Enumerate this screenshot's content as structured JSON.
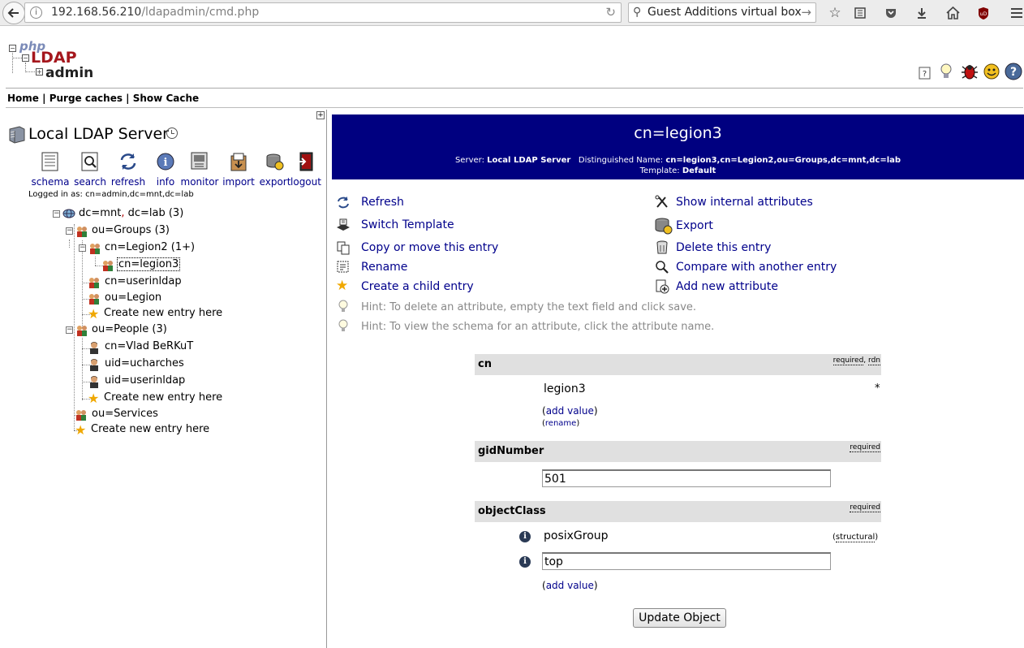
{
  "browser": {
    "url_host": "192.168.56.210",
    "url_path": "/ldapadmin/cmd.php",
    "search_text": "Guest Additions virtual box"
  },
  "app": {
    "logo_php": "php",
    "logo_ldap": "LDAP",
    "logo_admin": "admin",
    "nav": {
      "home": "Home",
      "sep1": " | ",
      "purge": "Purge caches",
      "sep2": " | ",
      "show_cache": "Show Cache"
    }
  },
  "server": {
    "title": "Local LDAP Server",
    "buttons": [
      {
        "label": "schema",
        "icon": "schema-icon"
      },
      {
        "label": "search",
        "icon": "search-icon"
      },
      {
        "label": "refresh",
        "icon": "refresh-icon"
      },
      {
        "label": "info",
        "icon": "info-icon"
      },
      {
        "label": "monitor",
        "icon": "monitor-icon"
      },
      {
        "label": "import",
        "icon": "import-icon"
      },
      {
        "label": "export",
        "icon": "export-icon"
      },
      {
        "label": "logout",
        "icon": "logout-icon"
      }
    ],
    "logged_in": "Logged in as: cn=admin,dc=mnt,dc=lab"
  },
  "tree": {
    "root_a": "dc",
    "root_b": "=mnt",
    "root_c": ",",
    "root_d": " dc",
    "root_e": "=lab (3)",
    "groups": "ou=Groups (3)",
    "legion2": "cn=Legion2 (1+)",
    "legion3": "cn=legion3",
    "userinldap_cn": "cn=userinldap",
    "legion_ou": "ou=Legion",
    "create_groups": "Create new entry here",
    "people": "ou=People (3)",
    "vlad": "cn=Vlad BeRKuT",
    "ucharches": "uid=ucharches",
    "userinldap_uid": "uid=userinldap",
    "create_people": "Create new entry here",
    "services": "ou=Services",
    "create_root": "Create new entry here"
  },
  "entry": {
    "title": "cn=legion3",
    "server_label": "Server:",
    "server_value": "Local LDAP Server",
    "dn_label": "Distinguished Name:",
    "dn_value": "cn=legion3,cn=Legion2,ou=Groups,dc=mnt,dc=lab",
    "template_label": "Template:",
    "template_value": "Default"
  },
  "actions": {
    "refresh": "Refresh",
    "switch_template": "Switch Template",
    "copy_move": "Copy or move this entry",
    "rename": "Rename",
    "create_child": "Create a child entry",
    "show_internal": "Show internal attributes",
    "export": "Export",
    "delete": "Delete this entry",
    "compare": "Compare with another entry",
    "add_attribute": "Add new attribute",
    "hint1": "Hint: To delete an attribute, empty the text field and click save.",
    "hint2": "Hint: To view the schema for an attribute, click the attribute name."
  },
  "attributes": {
    "cn": {
      "name": "cn",
      "flag_required": "required",
      "flag_sep": ", ",
      "flag_rdn": "rdn",
      "value": "legion3",
      "marker": "*",
      "add_value": "add value",
      "rename": "rename"
    },
    "gid": {
      "name": "gidNumber",
      "flag_required": "required",
      "value": "501"
    },
    "objectclass": {
      "name": "objectClass",
      "flag_required": "required",
      "value1": "posixGroup",
      "value1_note": "structural",
      "value2": "top",
      "add_value": "add value"
    }
  },
  "update_button": "Update Object"
}
